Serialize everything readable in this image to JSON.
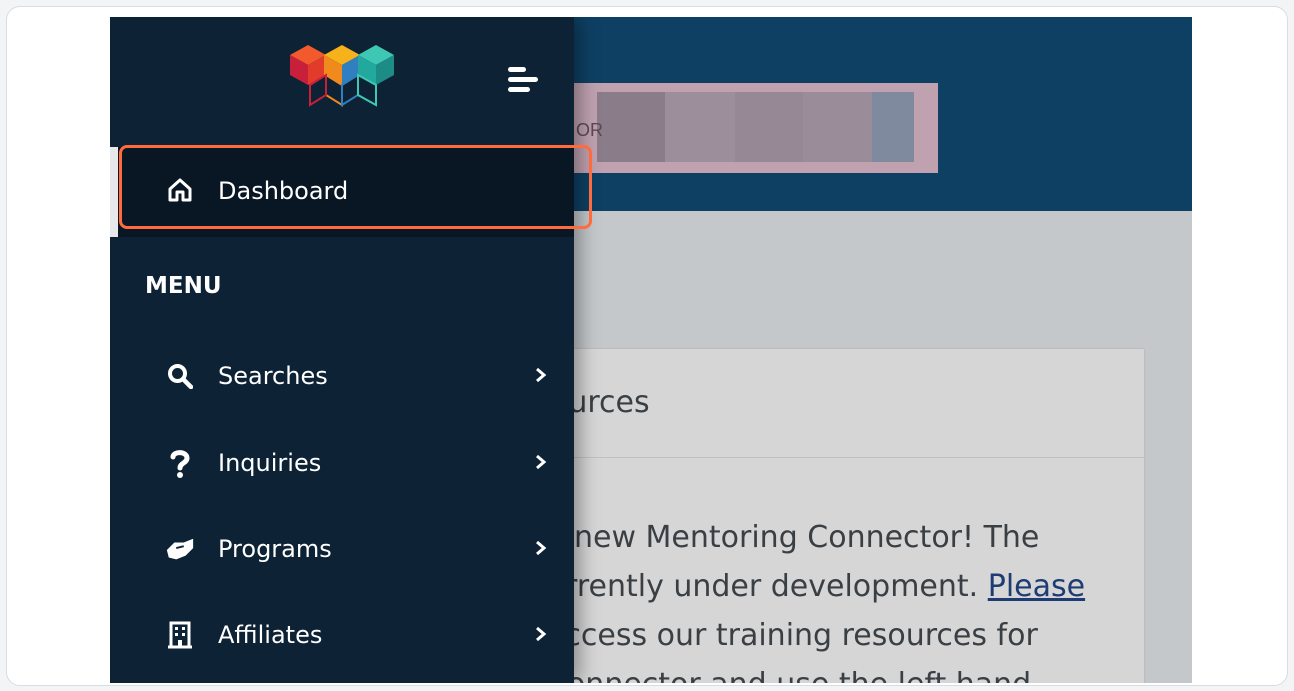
{
  "page": {
    "brand_prefix": "OR",
    "card": {
      "title_fragment": "ources",
      "body_lines": [
        "e new Mentoring Connector! The",
        "urrently under development. ",
        " access our training resources for",
        "Connector and use the left hand"
      ],
      "link_text": "Please"
    }
  },
  "sidebar": {
    "logo_icon": "mentor-hexagon-logo",
    "toggle_icon": "menu-toggle-icon",
    "dashboard_label": "Dashboard",
    "menu_heading": "MENU",
    "items": [
      {
        "label": "Searches",
        "icon": "search-icon"
      },
      {
        "label": "Inquiries",
        "icon": "question-icon"
      },
      {
        "label": "Programs",
        "icon": "handshake-icon"
      },
      {
        "label": "Affiliates",
        "icon": "building-icon"
      }
    ]
  },
  "colors": {
    "sidebar_bg": "#0d2235",
    "topbar_bg": "#0e4064",
    "highlight": "#ff6b3d"
  }
}
